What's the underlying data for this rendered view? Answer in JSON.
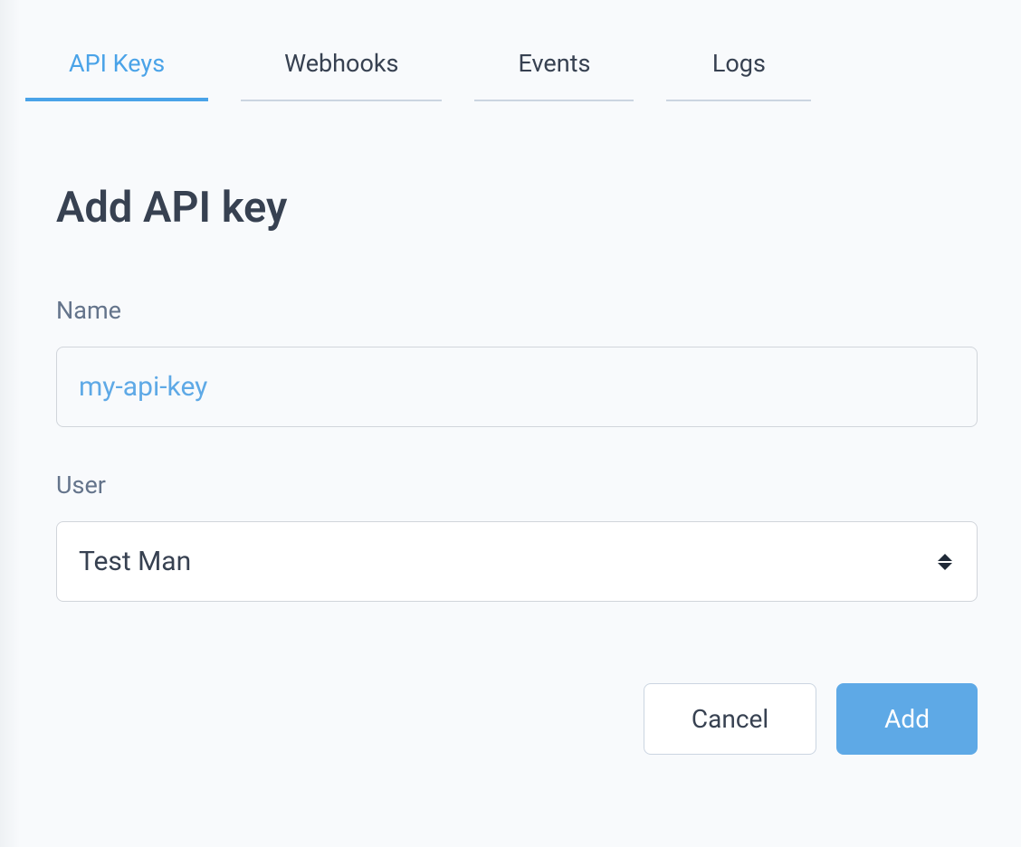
{
  "tabs": [
    {
      "label": "API Keys",
      "active": true
    },
    {
      "label": "Webhooks",
      "active": false
    },
    {
      "label": "Events",
      "active": false
    },
    {
      "label": "Logs",
      "active": false
    }
  ],
  "page": {
    "title": "Add API key"
  },
  "form": {
    "name": {
      "label": "Name",
      "value": "my-api-key"
    },
    "user": {
      "label": "User",
      "value": "Test Man"
    }
  },
  "actions": {
    "cancel": "Cancel",
    "add": "Add"
  },
  "colors": {
    "accent": "#5ea9e6",
    "text": "#374151",
    "muted": "#64748b",
    "border": "#d1d5db"
  }
}
